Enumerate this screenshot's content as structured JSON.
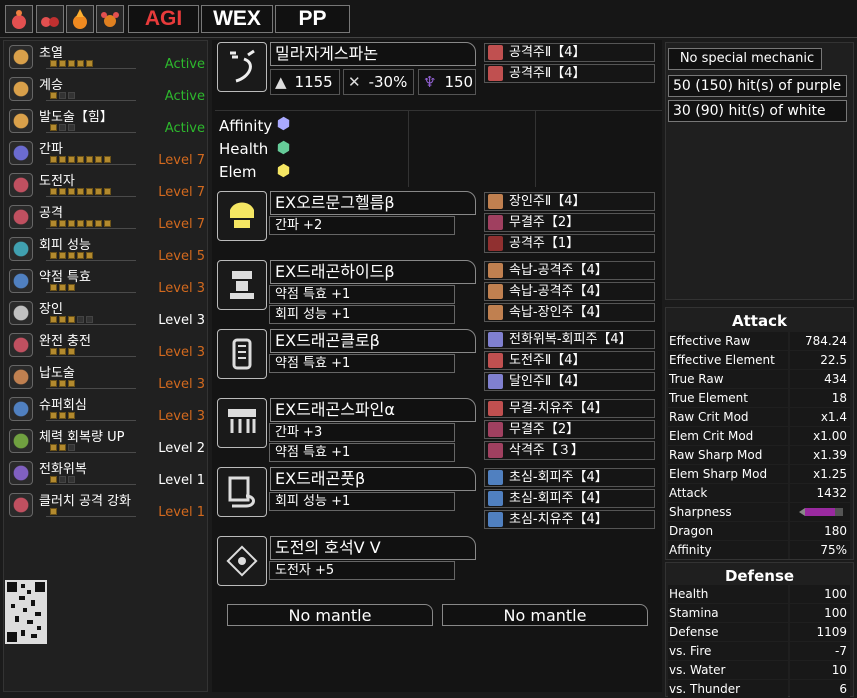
{
  "topbar": {
    "icons": [
      "flame-slime-icon",
      "dual-slime-icon",
      "fire-slime-icon",
      "fire-bug-icon"
    ],
    "buttons": [
      {
        "label": "AGI",
        "color": "#e83b3b"
      },
      {
        "label": "WEX",
        "color": "#ffffff"
      },
      {
        "label": "PP",
        "color": "#ffffff"
      }
    ]
  },
  "sidebar": {
    "skills": [
      {
        "name": "초열",
        "pips": 5,
        "max": 5,
        "level": "Active",
        "color": "#2db82d"
      },
      {
        "name": "계승",
        "pips": 1,
        "max": 3,
        "level": "Active",
        "color": "#2db82d"
      },
      {
        "name": "발도술【힘】",
        "pips": 1,
        "max": 3,
        "level": "Active",
        "color": "#2db82d"
      },
      {
        "name": "간파",
        "pips": 7,
        "max": 7,
        "level": "Level 7",
        "color": "#d2691e"
      },
      {
        "name": "도전자",
        "pips": 7,
        "max": 7,
        "level": "Level 7",
        "color": "#d2691e"
      },
      {
        "name": "공격",
        "pips": 7,
        "max": 7,
        "level": "Level 7",
        "color": "#d2691e"
      },
      {
        "name": "회피 성능",
        "pips": 5,
        "max": 5,
        "level": "Level 5",
        "color": "#d2691e"
      },
      {
        "name": "약점 특효",
        "pips": 3,
        "max": 3,
        "level": "Level 3",
        "color": "#d2691e"
      },
      {
        "name": "장인",
        "pips": 3,
        "max": 5,
        "level": "Level 3",
        "color": "#ffffff"
      },
      {
        "name": "완전 충전",
        "pips": 3,
        "max": 3,
        "level": "Level 3",
        "color": "#d2691e"
      },
      {
        "name": "납도술",
        "pips": 3,
        "max": 3,
        "level": "Level 3",
        "color": "#d2691e"
      },
      {
        "name": "슈퍼회심",
        "pips": 3,
        "max": 3,
        "level": "Level 3",
        "color": "#d2691e"
      },
      {
        "name": "체력 회복량 UP",
        "pips": 2,
        "max": 3,
        "level": "Level 2",
        "color": "#ffffff"
      },
      {
        "name": "전화위복",
        "pips": 1,
        "max": 3,
        "level": "Level 1",
        "color": "#ffffff"
      },
      {
        "name": "클러치 공격 강화",
        "pips": 1,
        "max": 1,
        "level": "Level 1",
        "color": "#d2691e"
      }
    ]
  },
  "weapon": {
    "name": "밀라자게스파논",
    "stats": [
      {
        "icon": "attack-icon",
        "value": "1155"
      },
      {
        "icon": "affinity-icon",
        "value": "-30%"
      },
      {
        "icon": "dragon-element-icon",
        "value": "150"
      }
    ],
    "decos": [
      {
        "name": "공격주Ⅱ【4】",
        "color": "#c05050"
      },
      {
        "name": "공격주Ⅱ【4】",
        "color": "#c05050"
      }
    ],
    "affinity": {
      "labels": [
        "Affinity",
        "Health",
        "Elem"
      ],
      "colors": [
        "#a9a9ff",
        "#66cc99",
        "#f5e663"
      ]
    }
  },
  "armor": [
    {
      "name": "EX오르문그헬름β",
      "skills": [
        "간파 +2"
      ],
      "decos": [
        {
          "name": "장인주Ⅱ【4】",
          "color": "#c08050"
        },
        {
          "name": "무결주【2】",
          "color": "#a04060"
        },
        {
          "name": "공격주【1】",
          "color": "#903030"
        }
      ]
    },
    {
      "name": "EX드래곤하이드β",
      "skills": [
        "약점 특효 +1",
        "회피 성능 +1"
      ],
      "decos": [
        {
          "name": "속납-공격주【4】",
          "color": "#c08050"
        },
        {
          "name": "속납-공격주【4】",
          "color": "#c08050"
        },
        {
          "name": "속납-장인주【4】",
          "color": "#c08050"
        }
      ]
    },
    {
      "name": "EX드래곤클로β",
      "skills": [
        "약점 특효 +1"
      ],
      "decos": [
        {
          "name": "전화위복-회피주【4】",
          "color": "#8080d0"
        },
        {
          "name": "도전주Ⅱ【4】",
          "color": "#c05050"
        },
        {
          "name": "달인주Ⅱ【4】",
          "color": "#8080d0"
        }
      ]
    },
    {
      "name": "EX드래곤스파인α",
      "skills": [
        "간파 +3",
        "약점 특효 +1"
      ],
      "decos": [
        {
          "name": "무결-치유주【4】",
          "color": "#c05050"
        },
        {
          "name": "무결주【2】",
          "color": "#a04060"
        },
        {
          "name": "삭격주【３】",
          "color": "#a04060"
        }
      ]
    },
    {
      "name": "EX드래곤풋β",
      "skills": [
        "회피 성능 +1"
      ],
      "decos": [
        {
          "name": "초심-회피주【4】",
          "color": "#5080c0"
        },
        {
          "name": "초심-회피주【4】",
          "color": "#5080c0"
        },
        {
          "name": "초심-치유주【4】",
          "color": "#5080c0"
        }
      ]
    }
  ],
  "charm": {
    "name": "도전의 호석Ⅴ Ⅴ",
    "skill": "도전자 +5"
  },
  "mantles": [
    "No mantle",
    "No mantle"
  ],
  "mechanic": {
    "title": "No special mechanic",
    "hits": [
      "50 (150) hit(s) of purple",
      "30 (90) hit(s) of white"
    ]
  },
  "attack": {
    "title": "Attack",
    "rows": [
      [
        "Effective Raw",
        "784.24"
      ],
      [
        "Effective Element",
        "22.5"
      ],
      [
        "True Raw",
        "434"
      ],
      [
        "True Element",
        "18"
      ],
      [
        "Raw Crit Mod",
        "x1.4"
      ],
      [
        "Elem Crit Mod",
        "x1.00"
      ],
      [
        "Raw Sharp Mod",
        "x1.39"
      ],
      [
        "Elem Sharp Mod",
        "x1.25"
      ],
      [
        "Attack",
        "1432"
      ],
      [
        "Sharpness",
        ""
      ],
      [
        "Dragon",
        "180"
      ],
      [
        "Affinity",
        "75%"
      ]
    ]
  },
  "defense": {
    "title": "Defense",
    "rows": [
      [
        "Health",
        "100"
      ],
      [
        "Stamina",
        "100"
      ],
      [
        "Defense",
        "1109"
      ],
      [
        "vs. Fire",
        "-7"
      ],
      [
        "vs. Water",
        "10"
      ],
      [
        "vs. Thunder",
        "6"
      ]
    ]
  }
}
